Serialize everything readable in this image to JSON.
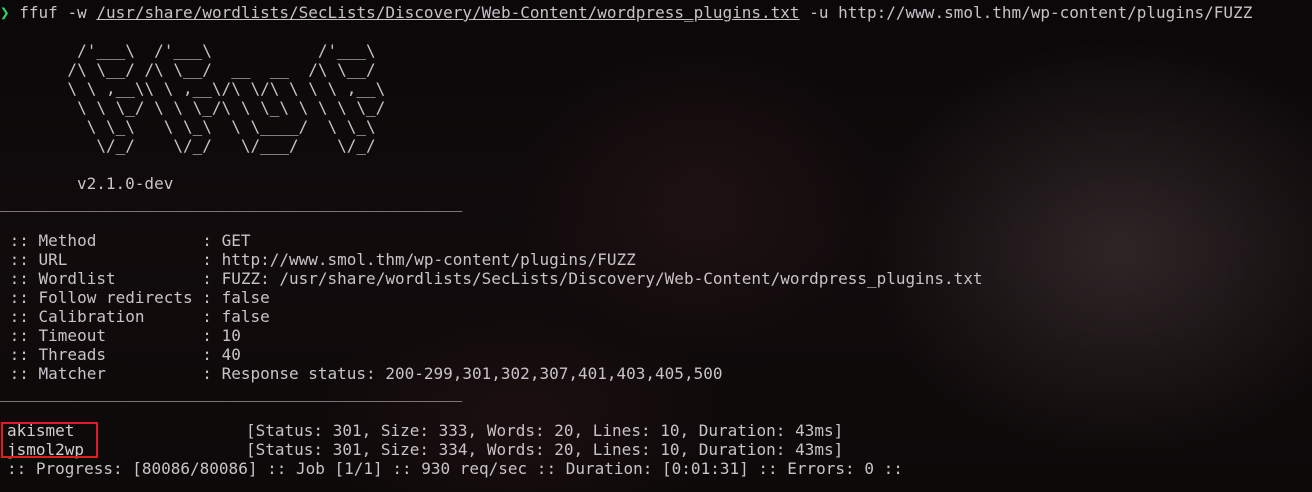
{
  "command": {
    "prompt_symbol": "❯",
    "program": "ffuf",
    "wordlist_flag": "-w",
    "wordlist_path": "/usr/share/wordlists/SecLists/Discovery/Web-Content/wordpress_plugins.txt",
    "url_flag": "-u",
    "url": "http://www.smol.thm/wp-content/plugins/FUZZ"
  },
  "banner": {
    "art": [
      "        /'___\\  /'___\\           /'___\\",
      "       /\\ \\__/ /\\ \\__/  __  __  /\\ \\__/",
      "       \\ \\ ,__\\\\ \\ ,__\\/\\ \\/\\ \\ \\ \\ ,__\\",
      "        \\ \\ \\_/ \\ \\ \\_/\\ \\ \\_\\ \\ \\ \\ \\_/",
      "         \\ \\_\\   \\ \\_\\  \\ \\____/  \\ \\_\\",
      "          \\/_/    \\/_/   \\/___/    \\/_/"
    ],
    "version": "v2.1.0-dev"
  },
  "separator": "________________________________________________",
  "config": [
    {
      "label": " :: Method           : ",
      "value": "GET"
    },
    {
      "label": " :: URL              : ",
      "value": "http://www.smol.thm/wp-content/plugins/FUZZ"
    },
    {
      "label": " :: Wordlist         : ",
      "value": "FUZZ: /usr/share/wordlists/SecLists/Discovery/Web-Content/wordpress_plugins.txt"
    },
    {
      "label": " :: Follow redirects : ",
      "value": "false"
    },
    {
      "label": " :: Calibration      : ",
      "value": "false"
    },
    {
      "label": " :: Timeout          : ",
      "value": "10"
    },
    {
      "label": " :: Threads          : ",
      "value": "40"
    },
    {
      "label": " :: Matcher          : ",
      "value": "Response status: 200-299,301,302,307,401,403,405,500"
    }
  ],
  "results": [
    {
      "word": "akismet",
      "details": "[Status: 301, Size: 333, Words: 20, Lines: 10, Duration: 43ms]"
    },
    {
      "word": "jsmol2wp",
      "details": "[Status: 301, Size: 334, Words: 20, Lines: 10, Duration: 43ms]"
    }
  ],
  "progress": ":: Progress: [80086/80086] :: Job [1/1] :: 930 req/sec :: Duration: [0:01:31] :: Errors: 0 ::",
  "colors": {
    "prompt": "#37d06b",
    "text": "#c7c3c8",
    "highlight_border": "#e01b24",
    "background": "#0c0809"
  }
}
